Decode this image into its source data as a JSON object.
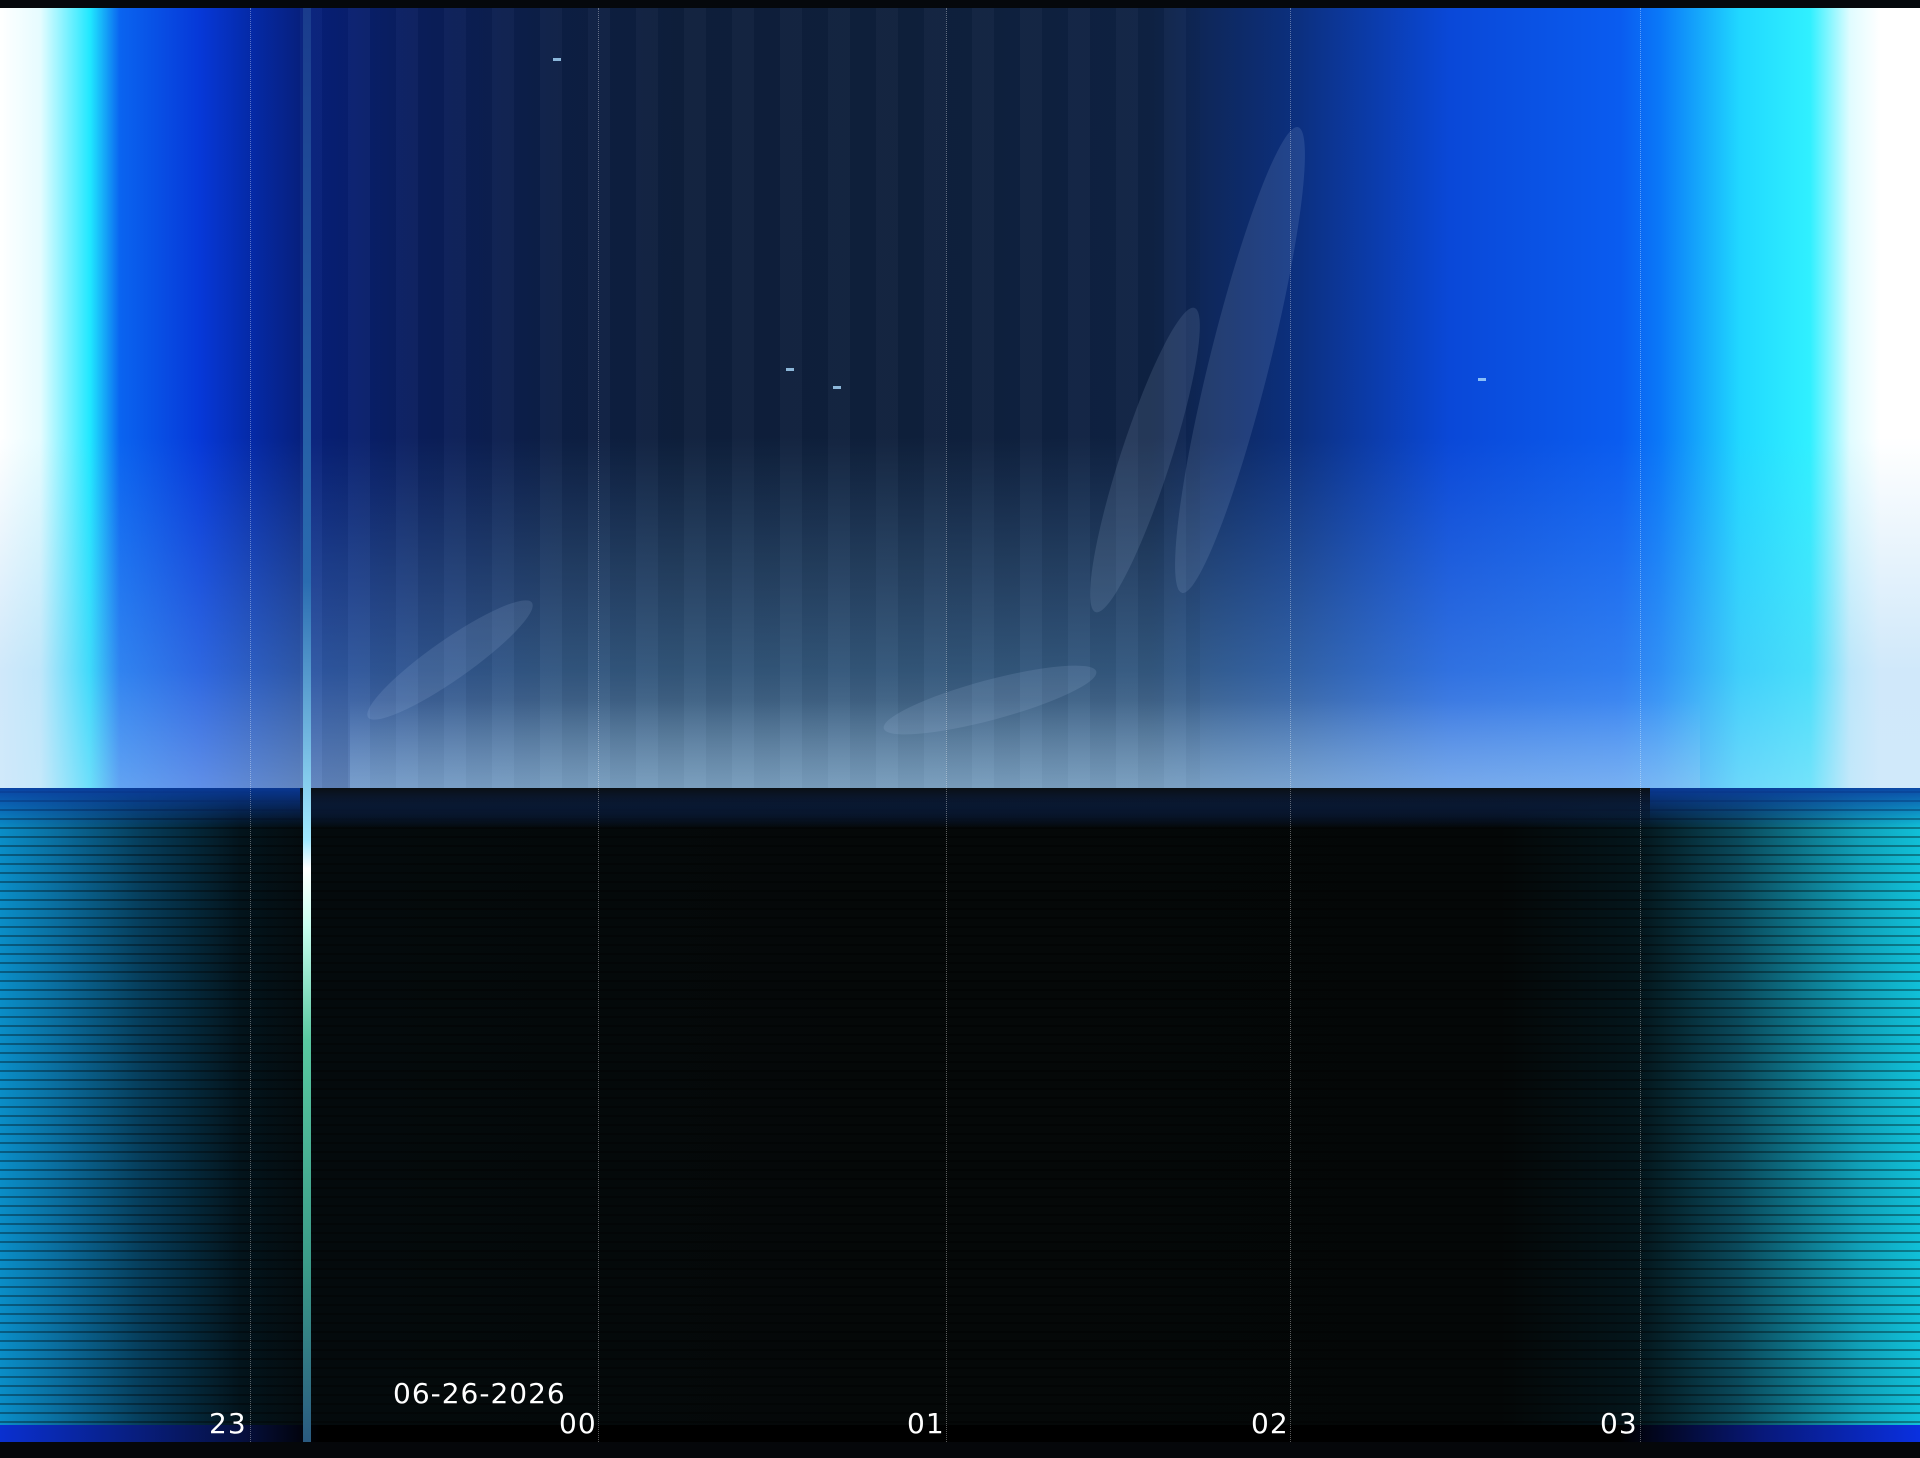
{
  "date_label": "06-26-2026",
  "hour_ticks": [
    "23",
    "00",
    "01",
    "02",
    "03"
  ]
}
